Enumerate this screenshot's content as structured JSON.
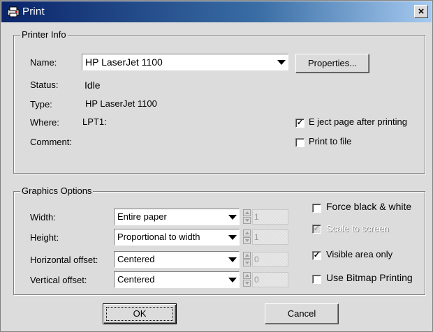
{
  "window": {
    "title": "Print",
    "close_label": "×"
  },
  "printer_info": {
    "legend": "Printer Info",
    "name_label": "Name:",
    "name_value": "HP LaserJet 1100",
    "properties_label": "Properties...",
    "status_label": "Status:",
    "status_value": "Idle",
    "type_label": "Type:",
    "type_value": "HP LaserJet 1100",
    "where_label": "Where:",
    "where_value": "LPT1:",
    "comment_label": "Comment:",
    "eject_label": "E ject page after printing",
    "eject_checked": true,
    "print_to_file_label": "Print to file",
    "print_to_file_checked": false
  },
  "graphics": {
    "legend": "Graphics Options",
    "width_label": "Width:",
    "width_value": "Entire paper",
    "width_num": "1",
    "height_label": "Height:",
    "height_value": "Proportional to width",
    "height_num": "1",
    "hoffset_label": "Horizontal offset:",
    "hoffset_value": "Centered",
    "hoffset_num": "0",
    "voffset_label": "Vertical offset:",
    "voffset_value": "Centered",
    "voffset_num": "0",
    "force_bw_label": "Force black & white",
    "force_bw_checked": false,
    "scale_label": "Scale to screen",
    "scale_checked": true,
    "scale_disabled": true,
    "visible_label": "Visible area only",
    "visible_checked": true,
    "bitmap_label": "Use Bitmap Printing",
    "bitmap_checked": false
  },
  "buttons": {
    "ok": "OK",
    "cancel": "Cancel"
  },
  "marks": {
    "check": "✓"
  }
}
